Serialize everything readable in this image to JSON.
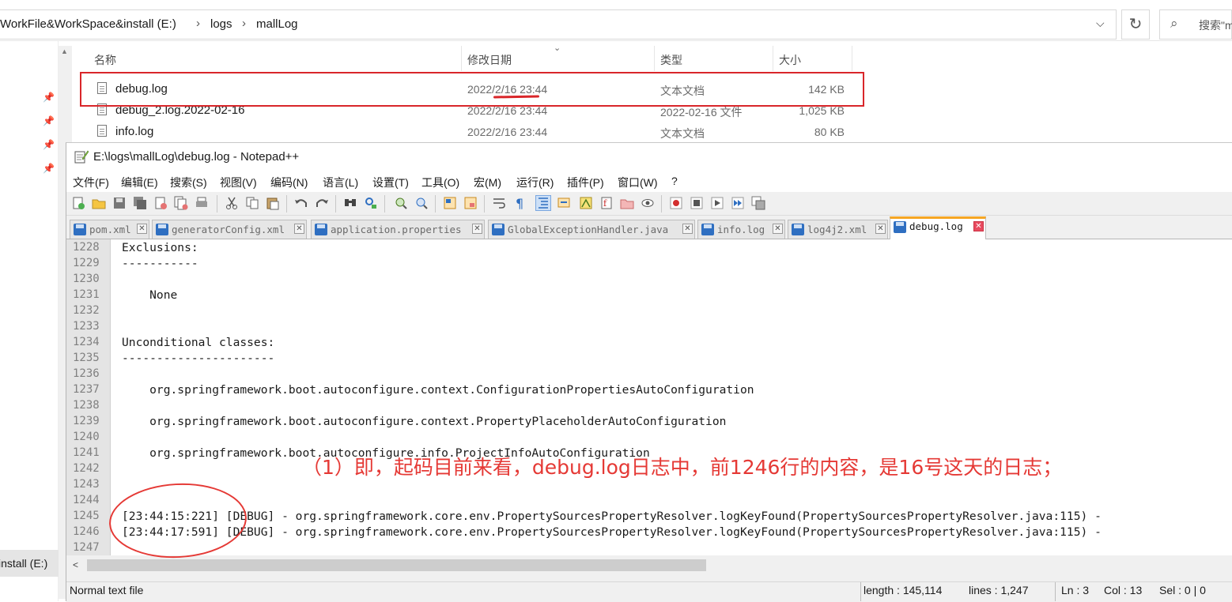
{
  "explorer": {
    "breadcrumbs": [
      "WorkFile&WorkSpace&install (E:)",
      "logs",
      "mallLog"
    ],
    "search_placeholder": "搜索\"m",
    "nav_drive": "install (E:)",
    "columns": [
      "名称",
      "修改日期",
      "类型",
      "大小"
    ],
    "files": [
      {
        "name": "debug.log",
        "date": "2022/2/16 23:44",
        "type": "文本文档",
        "size": "142 KB"
      },
      {
        "name": "debug_2.log.2022-02-16",
        "date": "2022/2/16 23:44",
        "type": "2022-02-16 文件",
        "size": "1,025 KB"
      },
      {
        "name": "info.log",
        "date": "2022/2/16 23:44",
        "type": "文本文档",
        "size": "80 KB"
      }
    ]
  },
  "npp": {
    "title": "E:\\logs\\mallLog\\debug.log - Notepad++",
    "menu": [
      "文件(F)",
      "编辑(E)",
      "搜索(S)",
      "视图(V)",
      "编码(N)",
      "语言(L)",
      "设置(T)",
      "工具(O)",
      "宏(M)",
      "运行(R)",
      "插件(P)",
      "窗口(W)",
      "?"
    ],
    "tabs": [
      "pom.xml",
      "generatorConfig.xml",
      "application.properties",
      "GlobalExceptionHandler.java",
      "info.log",
      "log4j2.xml",
      "debug.log"
    ],
    "active_tab": "debug.log",
    "lines": [
      {
        "n": "1228",
        "text": "Exclusions:"
      },
      {
        "n": "1229",
        "text": "-----------"
      },
      {
        "n": "1230",
        "text": ""
      },
      {
        "n": "1231",
        "text": "    None"
      },
      {
        "n": "1232",
        "text": ""
      },
      {
        "n": "1233",
        "text": ""
      },
      {
        "n": "1234",
        "text": "Unconditional classes:"
      },
      {
        "n": "1235",
        "text": "----------------------"
      },
      {
        "n": "1236",
        "text": ""
      },
      {
        "n": "1237",
        "text": "    org.springframework.boot.autoconfigure.context.ConfigurationPropertiesAutoConfiguration"
      },
      {
        "n": "1238",
        "text": ""
      },
      {
        "n": "1239",
        "text": "    org.springframework.boot.autoconfigure.context.PropertyPlaceholderAutoConfiguration"
      },
      {
        "n": "1240",
        "text": ""
      },
      {
        "n": "1241",
        "text": "    org.springframework.boot.autoconfigure.info.ProjectInfoAutoConfiguration"
      },
      {
        "n": "1242",
        "text": ""
      },
      {
        "n": "1243",
        "text": ""
      },
      {
        "n": "1244",
        "text": ""
      },
      {
        "n": "1245",
        "text": "[23:44:15:221] [DEBUG] - org.springframework.core.env.PropertySourcesPropertyResolver.logKeyFound(PropertySourcesPropertyResolver.java:115) -"
      },
      {
        "n": "1246",
        "text": "[23:44:17:591] [DEBUG] - org.springframework.core.env.PropertySourcesPropertyResolver.logKeyFound(PropertySourcesPropertyResolver.java:115) -"
      },
      {
        "n": "1247",
        "text": ""
      }
    ],
    "status": {
      "file_type": "Normal text file",
      "length": "length : 145,114",
      "lines": "lines : 1,247",
      "ln": "Ln : 3",
      "col": "Col : 13",
      "sel": "Sel : 0 | 0"
    }
  },
  "annotation": "（1）即，起码目前来看，debug.log日志中，前1246行的内容，是16号这天的日志；",
  "colors": {
    "annotation_red": "#e53935",
    "tab_active_accent": "#f6a623",
    "save_blue": "#2f6fc1"
  }
}
